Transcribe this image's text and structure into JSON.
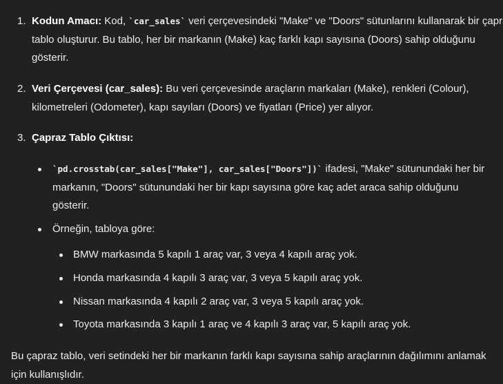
{
  "list": [
    {
      "number": "1.",
      "title": "Kodun Amacı:",
      "text_a": " Kod, ",
      "code": "`car_sales`",
      "text_b": " veri çerçevesindeki \"Make\" ve \"Doors\" sütunlarını kullanarak bir çapraz tablo oluşturur. Bu tablo, her bir markanın (Make) kaç farklı kapı sayısına (Doors) sahip olduğunu gösterir."
    },
    {
      "number": "2.",
      "title": "Veri Çerçevesi (car_sales):",
      "text": " Bu veri çerçevesinde araçların markaları (Make), renkleri (Colour), kilometreleri (Odometer), kapı sayıları (Doors) ve fiyatları (Price) yer alıyor."
    },
    {
      "number": "3.",
      "title": "Çapraz Tablo Çıktısı:"
    }
  ],
  "bullets": {
    "b1_code": "`pd.crosstab(car_sales[\"Make\"], car_sales[\"Doors\"])`",
    "b1_text": " ifadesi, \"Make\" sütunundaki her bir markanın, \"Doors\" sütunundaki her bir kapı sayısına göre kaç adet araca sahip olduğunu gösterir.",
    "b2_text": "Örneğin, tabloya göre:",
    "sub": [
      "BMW markasında 5 kapılı 1 araç var, 3 veya 4 kapılı araç yok.",
      "Honda markasında 4 kapılı 3 araç var, 3 veya 5 kapılı araç yok.",
      "Nissan markasında 4 kapılı 2 araç var, 3 veya 5 kapılı araç yok.",
      "Toyota markasında 3 kapılı 1 araç ve 4 kapılı 3 araç var, 5 kapılı araç yok."
    ]
  },
  "outro": "Bu çapraz tablo, veri setindeki her bir markanın farklı kapı sayısına sahip araçlarının dağılımını anlamak için kullanışlıdır."
}
